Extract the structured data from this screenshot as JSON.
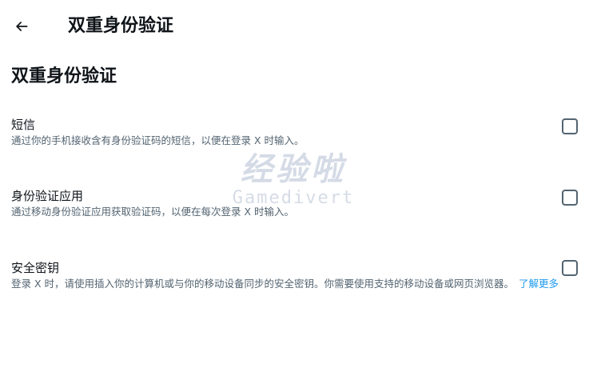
{
  "header": {
    "back_icon": "arrow-left-icon",
    "title": "双重身份验证"
  },
  "section": {
    "title": "双重身份验证"
  },
  "options": [
    {
      "label": "短信",
      "description": "通过你的手机接收含有身份验证码的短信，以便在登录 X 时输入。",
      "checked": false
    },
    {
      "label": "身份验证应用",
      "description": "通过移动身份验证应用获取验证码，以便在每次登录 X 时输入。",
      "checked": false
    },
    {
      "label": "安全密钥",
      "description": "登录 X 时，请使用插入你的计算机或与你的移动设备同步的安全密钥。你需要使用支持的移动设备或网页浏览器。",
      "learn_more": "了解更多",
      "checked": false
    }
  ],
  "watermark": {
    "cn": "经验啦",
    "en": "Gamedivert"
  },
  "colors": {
    "text_primary": "#0f1419",
    "text_secondary": "#536471",
    "link": "#1d9bf0",
    "background": "#ffffff"
  }
}
